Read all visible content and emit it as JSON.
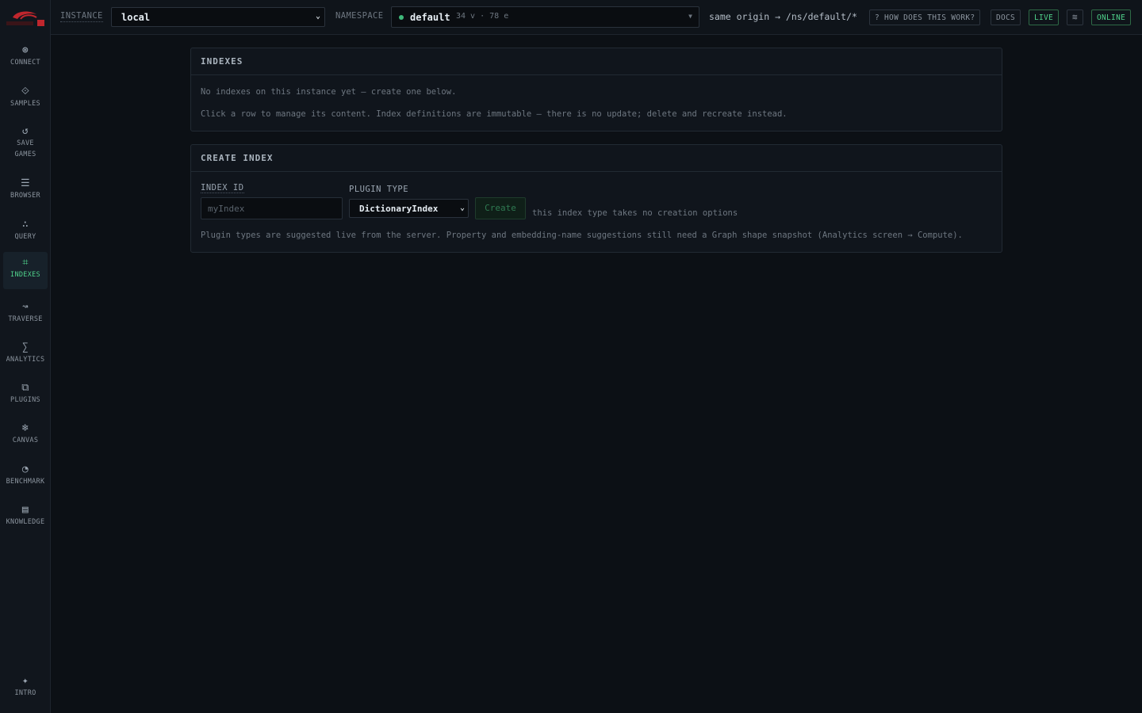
{
  "sidebar": {
    "items": [
      {
        "icon": "connect-icon",
        "glyph": "⊛",
        "label": "CONNECT"
      },
      {
        "icon": "samples-icon",
        "glyph": "⟐",
        "label": "SAMPLES"
      },
      {
        "icon": "save-games-icon",
        "glyph": "↺",
        "label": "SAVE\nGAMES"
      },
      {
        "icon": "browser-icon",
        "glyph": "☰",
        "label": "BROWSER"
      },
      {
        "icon": "query-icon",
        "glyph": "∴",
        "label": "QUERY"
      },
      {
        "icon": "indexes-icon",
        "glyph": "⌗",
        "label": "INDEXES",
        "active": true
      },
      {
        "icon": "traverse-icon",
        "glyph": "↝",
        "label": "TRAVERSE"
      },
      {
        "icon": "analytics-icon",
        "glyph": "∑",
        "label": "ANALYTICS"
      },
      {
        "icon": "plugins-icon",
        "glyph": "⧉",
        "label": "PLUGINS"
      },
      {
        "icon": "canvas-icon",
        "glyph": "❄",
        "label": "CANVAS"
      },
      {
        "icon": "benchmark-icon",
        "glyph": "◔",
        "label": "BENCHMARK"
      },
      {
        "icon": "knowledge-icon",
        "glyph": "▤",
        "label": "KNOWLEDGE"
      }
    ],
    "intro": {
      "icon": "intro-icon",
      "glyph": "✦",
      "label": "INTRO"
    }
  },
  "topbar": {
    "instance_label": "INSTANCE",
    "instance_value": "local",
    "namespace_label": "NAMESPACE",
    "namespace_value": "default",
    "namespace_stats": "34 v · 78 e",
    "origin": "same origin → /ns/default/*",
    "help": "? HOW DOES THIS WORK?",
    "docs": "DOCS",
    "live": "LIVE",
    "status": "ONLINE"
  },
  "indexes_panel": {
    "title": "INDEXES",
    "empty": "No indexes on this instance yet — create one below.",
    "hint": "Click a row to manage its content. Index definitions are immutable — there is no update; delete and recreate instead."
  },
  "create_panel": {
    "title": "CREATE INDEX",
    "id_label": "INDEX ID",
    "id_placeholder": "myIndex",
    "type_label": "PLUGIN TYPE",
    "type_value": "DictionaryIndex",
    "create_label": "Create",
    "options_note": "this index type takes no creation options",
    "footer": "Plugin types are suggested live from the server. Property and embedding-name suggestions still need a Graph shape snapshot (Analytics screen → Compute)."
  },
  "colors": {
    "accent": "#4fd08a",
    "background": "#0c1015",
    "panel": "#10151c"
  }
}
